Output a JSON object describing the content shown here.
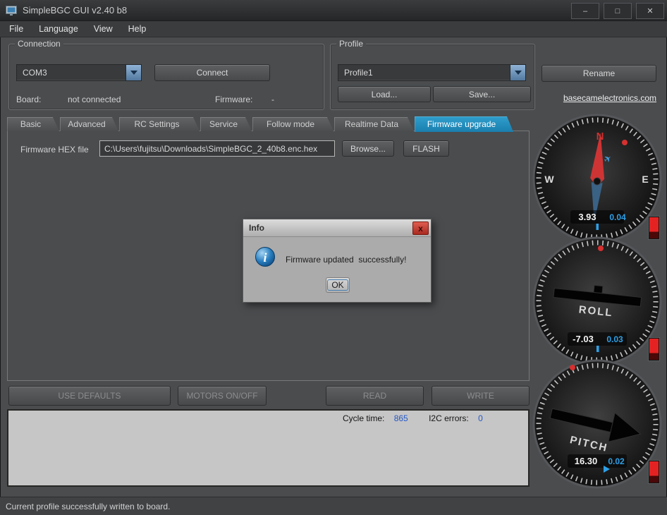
{
  "colors": {
    "accent_blue": "#1e86b7",
    "telemetry_blue": "#2da0e8",
    "alert_red": "#d42020"
  },
  "window": {
    "title": "SimpleBGC GUI v2.40 b8",
    "controls": {
      "minimize": "–",
      "maximize": "□",
      "close": "✕"
    }
  },
  "menu": {
    "items": [
      "File",
      "Language",
      "View",
      "Help"
    ]
  },
  "connection": {
    "group_label": "Connection",
    "port": "COM3",
    "connect_label": "Connect",
    "board_label": "Board:",
    "board_value": "not connected",
    "firmware_label": "Firmware:",
    "firmware_value": "-"
  },
  "profile": {
    "group_label": "Profile",
    "selected": "Profile1",
    "rename_label": "Rename",
    "load_label": "Load...",
    "save_label": "Save...",
    "website_link": "basecamelectronics.com"
  },
  "tabs": {
    "labels": [
      "Basic",
      "Advanced",
      "RC Settings",
      "Service",
      "Follow mode",
      "Realtime Data",
      "Firmware upgrade"
    ],
    "active": "Firmware upgrade"
  },
  "firmware": {
    "hex_label": "Firmware HEX file",
    "hex_path": "C:\\Users\\fujitsu\\Downloads\\SimpleBGC_2_40b8.enc.hex",
    "browse_label": "Browse...",
    "flash_label": "FLASH"
  },
  "dialog": {
    "title": "Info",
    "message": "Firmware updated  successfully!",
    "ok_label": "OK",
    "close_glyph": "x"
  },
  "actions": {
    "use_defaults": "USE DEFAULTS",
    "motors": "MOTORS ON/OFF",
    "read": "READ",
    "write": "WRITE"
  },
  "telemetry": {
    "cycle_time_label": "Cycle time:",
    "cycle_time_value": "865",
    "i2c_errors_label": "I2C errors:",
    "i2c_errors_value": "0"
  },
  "status_bar": {
    "message": "Current profile successfully written to board."
  },
  "gauges": {
    "heading": {
      "cardinal_n": "N",
      "cardinal_e": "E",
      "cardinal_w": "W",
      "value": "3.93",
      "value2": "0.04"
    },
    "roll": {
      "label": "ROLL",
      "value": "-7.03",
      "value2": "0.03"
    },
    "pitch": {
      "label": "PITCH",
      "value": "16.30",
      "value2": "0.02"
    }
  }
}
